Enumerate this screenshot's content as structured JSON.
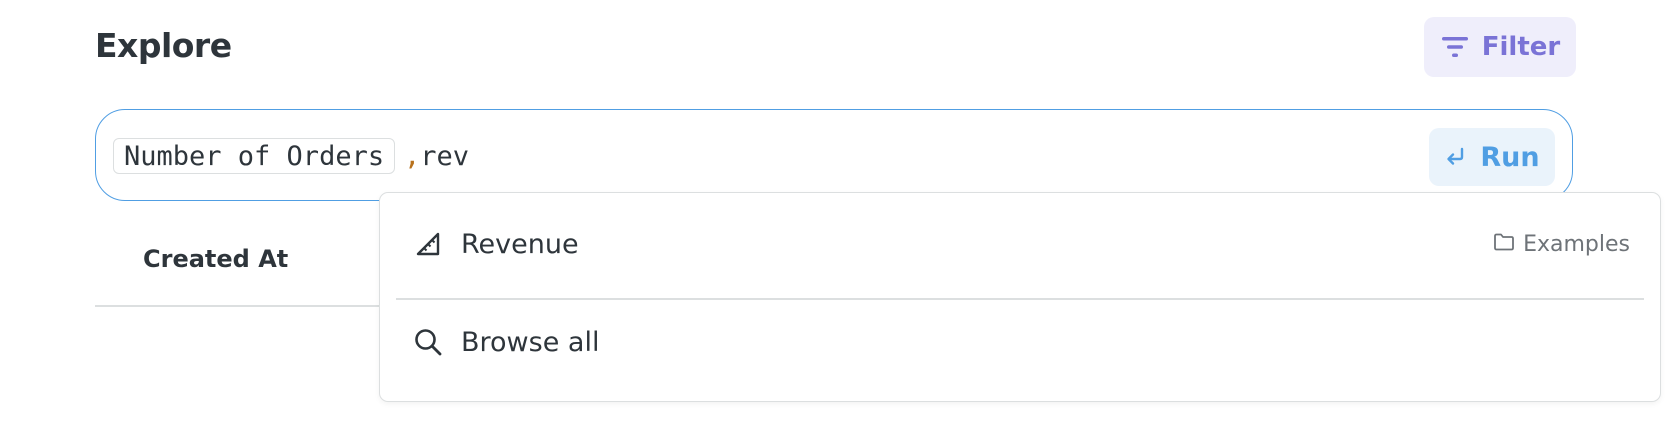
{
  "header": {
    "title": "Explore",
    "filter_label": "Filter"
  },
  "query": {
    "token": "Number of Orders",
    "separator": ",",
    "typed_text": "rev",
    "run_label": "Run"
  },
  "table": {
    "columns": [
      "Created At"
    ]
  },
  "suggestions": {
    "items": [
      {
        "label": "Revenue",
        "icon": "metric-ruler-icon",
        "collection": "Examples",
        "collection_icon": "folder-icon"
      },
      {
        "label": "Browse all",
        "icon": "search-icon"
      }
    ]
  },
  "colors": {
    "accent": "#509ee3",
    "filter": "#7a73d6",
    "text": "#2e353b",
    "border": "#dcdfe0"
  }
}
